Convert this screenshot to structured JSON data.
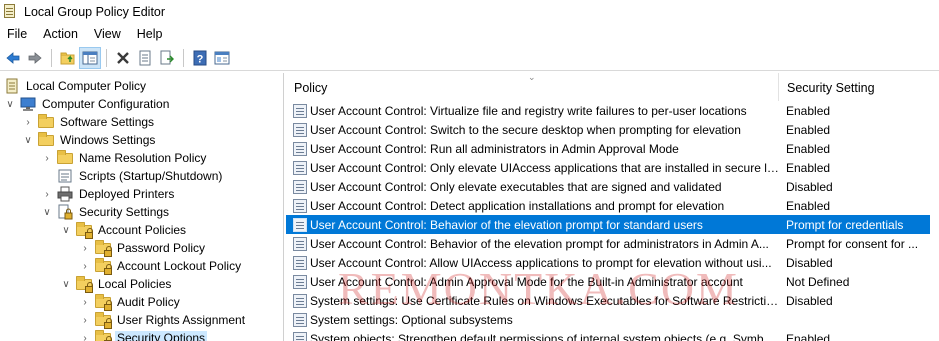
{
  "window": {
    "title": "Local Group Policy Editor"
  },
  "menu": [
    "File",
    "Action",
    "View",
    "Help"
  ],
  "toolbar": [
    {
      "name": "back-arrow-icon"
    },
    {
      "name": "forward-arrow-icon"
    },
    {
      "name": "up-folder-icon"
    },
    {
      "name": "show-hide-tree-icon"
    },
    {
      "name": "delete-icon"
    },
    {
      "name": "properties-icon"
    },
    {
      "name": "export-list-icon"
    },
    {
      "name": "help-icon"
    },
    {
      "name": "extended-view-icon"
    }
  ],
  "tree": [
    {
      "label": "Local Computer Policy",
      "level": 0,
      "expander": "",
      "icon": "policy"
    },
    {
      "label": "Computer Configuration",
      "level": 1,
      "expander": "open",
      "icon": "computer"
    },
    {
      "label": "Software Settings",
      "level": 2,
      "expander": "closed",
      "icon": "folder"
    },
    {
      "label": "Windows Settings",
      "level": 2,
      "expander": "open",
      "icon": "folder"
    },
    {
      "label": "Name Resolution Policy",
      "level": 3,
      "expander": "closed",
      "icon": "folder"
    },
    {
      "label": "Scripts (Startup/Shutdown)",
      "level": 3,
      "expander": "",
      "icon": "scripts"
    },
    {
      "label": "Deployed Printers",
      "level": 3,
      "expander": "closed",
      "icon": "printer"
    },
    {
      "label": "Security Settings",
      "level": 3,
      "expander": "open",
      "icon": "security"
    },
    {
      "label": "Account Policies",
      "level": 4,
      "expander": "open",
      "icon": "folder-lock"
    },
    {
      "label": "Password Policy",
      "level": 5,
      "expander": "closed",
      "icon": "folder-lock"
    },
    {
      "label": "Account Lockout Policy",
      "level": 5,
      "expander": "closed",
      "icon": "folder-lock"
    },
    {
      "label": "Local Policies",
      "level": 4,
      "expander": "open",
      "icon": "folder-lock"
    },
    {
      "label": "Audit Policy",
      "level": 5,
      "expander": "closed",
      "icon": "folder-lock"
    },
    {
      "label": "User Rights Assignment",
      "level": 5,
      "expander": "closed",
      "icon": "folder-lock"
    },
    {
      "label": "Security Options",
      "level": 5,
      "expander": "closed",
      "icon": "folder-lock",
      "selected": true
    }
  ],
  "list": {
    "columns": {
      "policy": "Policy",
      "setting": "Security Setting"
    },
    "rows": [
      {
        "policy": "User Account Control: Virtualize file and registry write failures to per-user locations",
        "setting": "Enabled"
      },
      {
        "policy": "User Account Control: Switch to the secure desktop when prompting for elevation",
        "setting": "Enabled"
      },
      {
        "policy": "User Account Control: Run all administrators in Admin Approval Mode",
        "setting": "Enabled"
      },
      {
        "policy": "User Account Control: Only elevate UIAccess applications that are installed in secure lo...",
        "setting": "Enabled"
      },
      {
        "policy": "User Account Control: Only elevate executables that are signed and validated",
        "setting": "Disabled"
      },
      {
        "policy": "User Account Control: Detect application installations and prompt for elevation",
        "setting": "Enabled"
      },
      {
        "policy": "User Account Control: Behavior of the elevation prompt for standard users",
        "setting": "Prompt for credentials",
        "selected": true
      },
      {
        "policy": "User Account Control: Behavior of the elevation prompt for administrators in Admin A...",
        "setting": "Prompt for consent for ..."
      },
      {
        "policy": "User Account Control: Allow UIAccess applications to prompt for elevation without usi...",
        "setting": "Disabled"
      },
      {
        "policy": "User Account Control: Admin Approval Mode for the Built-in Administrator account",
        "setting": "Not Defined"
      },
      {
        "policy": "System settings: Use Certificate Rules on Windows Executables for Software Restriction ...",
        "setting": "Disabled"
      },
      {
        "policy": "System settings: Optional subsystems",
        "setting": ""
      },
      {
        "policy": "System objects: Strengthen default permissions of internal system objects (e.g. Symboli...",
        "setting": "Enabled"
      }
    ]
  },
  "watermark": "REMONTKA.COM",
  "colors": {
    "selection": "#0078d7",
    "tree_selection": "#cce8ff",
    "watermark": "#cd1e1e"
  }
}
